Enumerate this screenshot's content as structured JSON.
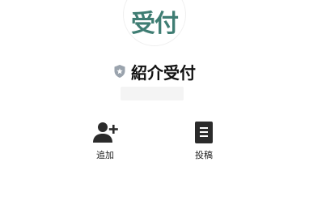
{
  "profile": {
    "avatar_text": "受付",
    "name": "紹介受付",
    "badge_icon": "shield-icon",
    "accent_color": "#3f7d73"
  },
  "actions": [
    {
      "label": "追加",
      "icon": "add-friend-icon"
    },
    {
      "label": "投稿",
      "icon": "posts-icon"
    }
  ]
}
